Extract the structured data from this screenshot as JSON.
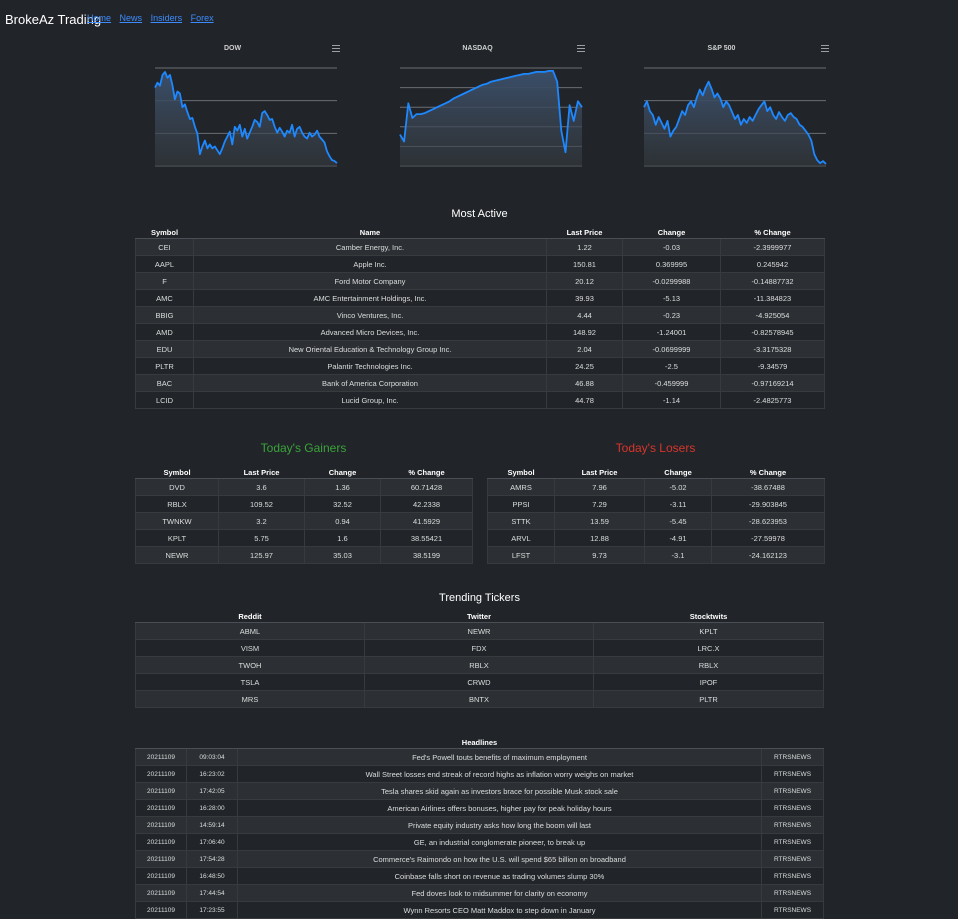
{
  "header": {
    "brand": "BrokeAz Trading",
    "nav": [
      "Home",
      "News",
      "Insiders",
      "Forex"
    ]
  },
  "colors": {
    "accent": "#1e88ff",
    "gainers": "#3aa33a",
    "losers": "#d9342b",
    "link": "#3d8bfd"
  },
  "charts": [
    {
      "title": "DOW",
      "menu_icon": "hamburger-menu-icon"
    },
    {
      "title": "NASDAQ",
      "menu_icon": "hamburger-menu-icon"
    },
    {
      "title": "S&P 500",
      "menu_icon": "hamburger-menu-icon"
    }
  ],
  "chart_data": [
    {
      "type": "area",
      "title": "DOW",
      "xlabel": "",
      "ylabel": "",
      "grid": true,
      "values": [
        0.8,
        0.85,
        0.82,
        0.93,
        0.96,
        0.9,
        0.93,
        0.82,
        0.68,
        0.76,
        0.74,
        0.6,
        0.63,
        0.55,
        0.48,
        0.49,
        0.4,
        0.33,
        0.12,
        0.2,
        0.26,
        0.18,
        0.22,
        0.18,
        0.2,
        0.16,
        0.12,
        0.18,
        0.25,
        0.3,
        0.35,
        0.22,
        0.4,
        0.36,
        0.42,
        0.3,
        0.38,
        0.28,
        0.34,
        0.4,
        0.47,
        0.45,
        0.4,
        0.54,
        0.56,
        0.52,
        0.47,
        0.48,
        0.4,
        0.34,
        0.39,
        0.35,
        0.3,
        0.36,
        0.34,
        0.42,
        0.3,
        0.38,
        0.4,
        0.34,
        0.3,
        0.28,
        0.34,
        0.3,
        0.32,
        0.36,
        0.3,
        0.27,
        0.24,
        0.15,
        0.1,
        0.06,
        0.05,
        0.03
      ]
    },
    {
      "type": "area",
      "title": "NASDAQ",
      "xlabel": "",
      "ylabel": "",
      "grid": true,
      "values": [
        0.32,
        0.25,
        0.64,
        0.49,
        0.53,
        0.53,
        0.54,
        0.56,
        0.58,
        0.6,
        0.62,
        0.64,
        0.66,
        0.69,
        0.71,
        0.73,
        0.75,
        0.77,
        0.79,
        0.81,
        0.83,
        0.84,
        0.86,
        0.87,
        0.88,
        0.89,
        0.9,
        0.91,
        0.92,
        0.93,
        0.94,
        0.94,
        0.95,
        0.96,
        0.96,
        0.96,
        0.97,
        0.97,
        0.86,
        0.36,
        0.14,
        0.62,
        0.46,
        0.66,
        0.6
      ]
    },
    {
      "type": "area",
      "title": "S&P 500",
      "xlabel": "",
      "ylabel": "",
      "grid": true,
      "values": [
        0.6,
        0.66,
        0.56,
        0.52,
        0.42,
        0.5,
        0.44,
        0.38,
        0.46,
        0.3,
        0.36,
        0.4,
        0.48,
        0.56,
        0.52,
        0.62,
        0.66,
        0.6,
        0.7,
        0.78,
        0.72,
        0.8,
        0.86,
        0.79,
        0.7,
        0.74,
        0.69,
        0.6,
        0.66,
        0.62,
        0.55,
        0.48,
        0.52,
        0.42,
        0.48,
        0.44,
        0.5,
        0.46,
        0.52,
        0.58,
        0.62,
        0.66,
        0.56,
        0.6,
        0.52,
        0.48,
        0.55,
        0.5,
        0.46,
        0.52,
        0.54,
        0.5,
        0.48,
        0.42,
        0.4,
        0.36,
        0.32,
        0.26,
        0.12,
        0.06,
        0.03,
        0.05,
        0.02
      ]
    }
  ],
  "most_active": {
    "title": "Most Active",
    "columns": [
      "Symbol",
      "Name",
      "Last Price",
      "Change",
      "% Change"
    ],
    "rows": [
      [
        "CEI",
        "Camber Energy, Inc.",
        "1.22",
        "-0.03",
        "-2.3999977"
      ],
      [
        "AAPL",
        "Apple Inc.",
        "150.81",
        "0.369995",
        "0.245942"
      ],
      [
        "F",
        "Ford Motor Company",
        "20.12",
        "-0.0299988",
        "-0.14887732"
      ],
      [
        "AMC",
        "AMC Entertainment Holdings, Inc.",
        "39.93",
        "-5.13",
        "-11.384823"
      ],
      [
        "BBIG",
        "Vinco Ventures, Inc.",
        "4.44",
        "-0.23",
        "-4.925054"
      ],
      [
        "AMD",
        "Advanced Micro Devices, Inc.",
        "148.92",
        "-1.24001",
        "-0.82578945"
      ],
      [
        "EDU",
        "New Oriental Education & Technology Group Inc.",
        "2.04",
        "-0.0699999",
        "-3.3175328"
      ],
      [
        "PLTR",
        "Palantir Technologies Inc.",
        "24.25",
        "-2.5",
        "-9.34579"
      ],
      [
        "BAC",
        "Bank of America Corporation",
        "46.88",
        "-0.459999",
        "-0.97169214"
      ],
      [
        "LCID",
        "Lucid Group, Inc.",
        "44.78",
        "-1.14",
        "-2.4825773"
      ]
    ]
  },
  "gainers": {
    "title": "Today's Gainers",
    "columns": [
      "Symbol",
      "Last Price",
      "Change",
      "% Change"
    ],
    "rows": [
      [
        "DVD",
        "3.6",
        "1.36",
        "60.71428"
      ],
      [
        "RBLX",
        "109.52",
        "32.52",
        "42.2338"
      ],
      [
        "TWNKW",
        "3.2",
        "0.94",
        "41.5929"
      ],
      [
        "KPLT",
        "5.75",
        "1.6",
        "38.55421"
      ],
      [
        "NEWR",
        "125.97",
        "35.03",
        "38.5199"
      ]
    ]
  },
  "losers": {
    "title": "Today's Losers",
    "columns": [
      "Symbol",
      "Last Price",
      "Change",
      "% Change"
    ],
    "rows": [
      [
        "AMRS",
        "7.96",
        "-5.02",
        "-38.67488"
      ],
      [
        "PPSI",
        "7.29",
        "-3.11",
        "-29.903845"
      ],
      [
        "STTK",
        "13.59",
        "-5.45",
        "-28.623953"
      ],
      [
        "ARVL",
        "12.88",
        "-4.91",
        "-27.59978"
      ],
      [
        "LFST",
        "9.73",
        "-3.1",
        "-24.162123"
      ]
    ]
  },
  "trending": {
    "title": "Trending Tickers",
    "columns": [
      "Reddit",
      "Twitter",
      "Stocktwits"
    ],
    "rows": [
      [
        "ABML",
        "NEWR",
        "KPLT"
      ],
      [
        "VISM",
        "FDX",
        "LRC.X"
      ],
      [
        "TWOH",
        "RBLX",
        "RBLX"
      ],
      [
        "TSLA",
        "CRWD",
        "IPOF"
      ],
      [
        "MRS",
        "BNTX",
        "PLTR"
      ]
    ]
  },
  "headlines": {
    "title": "Headlines",
    "rows": [
      [
        "20211109",
        "09:03:04",
        "Fed's Powell touts benefits of maximum employment",
        "RTRSNEWS"
      ],
      [
        "20211109",
        "16:23:02",
        "Wall Street losses end streak of record highs as inflation worry weighs on market",
        "RTRSNEWS"
      ],
      [
        "20211109",
        "17:42:05",
        "Tesla shares skid again as investors brace for possible Musk stock sale",
        "RTRSNEWS"
      ],
      [
        "20211109",
        "16:28:00",
        "American Airlines offers bonuses, higher pay for peak holiday hours",
        "RTRSNEWS"
      ],
      [
        "20211109",
        "14:59:14",
        "Private equity industry asks how long the boom will last",
        "RTRSNEWS"
      ],
      [
        "20211109",
        "17:06:40",
        "GE, an industrial conglomerate pioneer, to break up",
        "RTRSNEWS"
      ],
      [
        "20211109",
        "17:54:28",
        "Commerce's Raimondo on how the U.S. will spend $65 billion on broadband",
        "RTRSNEWS"
      ],
      [
        "20211109",
        "16:48:50",
        "Coinbase falls short on revenue as trading volumes slump 30%",
        "RTRSNEWS"
      ],
      [
        "20211109",
        "17:44:54",
        "Fed doves look to midsummer for clarity on economy",
        "RTRSNEWS"
      ],
      [
        "20211109",
        "17:23:55",
        "Wynn Resorts CEO Matt Maddox to step down in January",
        "RTRSNEWS"
      ]
    ]
  }
}
